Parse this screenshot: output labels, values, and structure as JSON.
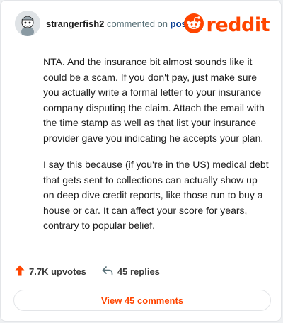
{
  "header": {
    "username": "strangerfish2",
    "action_text": "commented on",
    "post_link_label": "post",
    "logo_text": "reddit",
    "avatar_icon": "snoo-avatar-icon",
    "logo_icon": "reddit-snoo-icon"
  },
  "comment": {
    "paragraphs": [
      "NTA. And the insurance bit almost sounds like it could be a scam. If you don't pay, just make sure you actually write a formal letter to your insurance company disputing the claim. Attach the email with the time stamp as well as that list your insurance provider gave you indicating he accepts your plan.",
      "I say this because (if you're in the US) medical debt that gets sent to collections can actually show up on deep dive credit reports, like those run to buy a house or car. It can affect your score for years, contrary to popular belief."
    ]
  },
  "footer": {
    "upvotes_label": "7.7K upvotes",
    "replies_label": "45 replies",
    "view_comments_label": "View 45 comments",
    "upvote_icon": "upvote-arrow-icon",
    "reply_icon": "reply-arrow-icon"
  },
  "colors": {
    "brand": "#ff4500",
    "link": "#0a3f94",
    "muted": "#576f76"
  }
}
